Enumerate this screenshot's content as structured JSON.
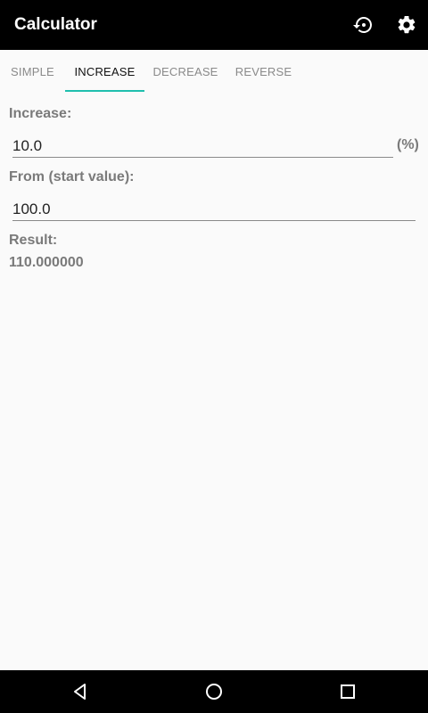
{
  "app": {
    "title": "Calculator",
    "actions": [
      "history-icon",
      "settings-icon"
    ]
  },
  "tabs": [
    "SIMPLE",
    "INCREASE",
    "DECREASE",
    "REVERSE"
  ],
  "active_tab": "INCREASE",
  "form": {
    "increase_label": "Increase:",
    "increase_value": "10.0",
    "increase_unit": "(%)",
    "from_label": "From (start value):",
    "from_value": "100.0",
    "result_label": "Result:",
    "result_value": "110.000000"
  },
  "navigation": [
    "back-icon",
    "home-icon",
    "recents-icon"
  ],
  "colors": {
    "appbar": "#000000",
    "accent": "#1fbfae",
    "background": "#fafafa",
    "label": "#7a7a7a"
  }
}
